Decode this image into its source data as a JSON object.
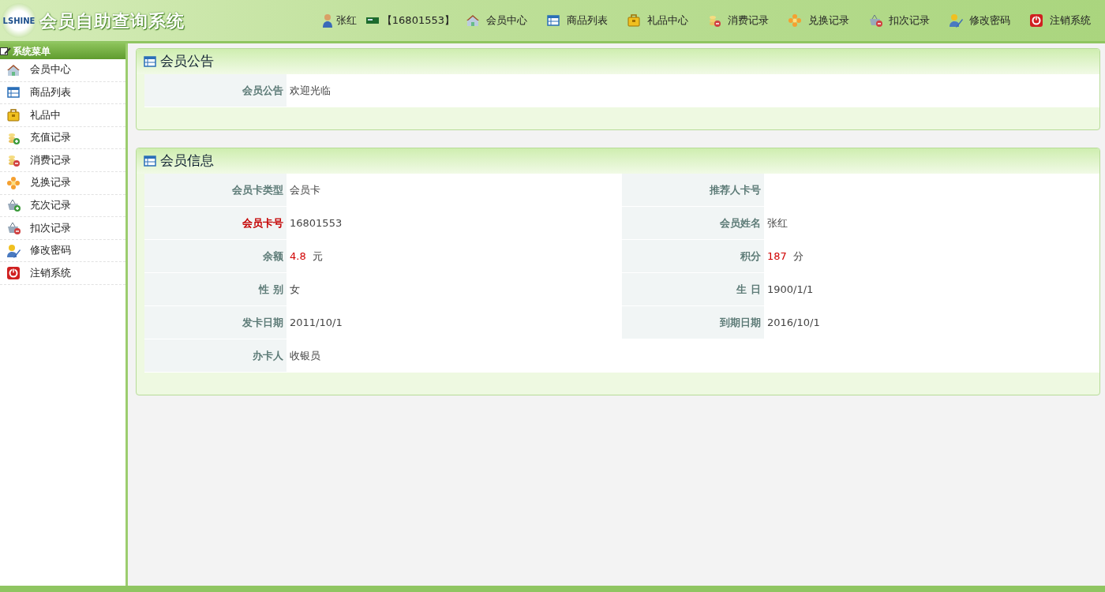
{
  "header": {
    "logo_text": "LSHINE",
    "title": "会员自助查询系统",
    "user_name": "张红",
    "card_number": "【16801553】",
    "nav": [
      {
        "label": "会员中心",
        "kind": "house"
      },
      {
        "label": "商品列表",
        "kind": "table"
      },
      {
        "label": "礼品中心",
        "kind": "bag"
      },
      {
        "label": "消费记录",
        "kind": "coins-minus"
      },
      {
        "label": "兑换记录",
        "kind": "flower"
      },
      {
        "label": "扣次记录",
        "kind": "basket-minus"
      },
      {
        "label": "修改密码",
        "kind": "pencil"
      },
      {
        "label": "注销系统",
        "kind": "power"
      }
    ]
  },
  "sidebar": {
    "title": "系统菜单",
    "items": [
      {
        "label": "会员中心",
        "kind": "house"
      },
      {
        "label": "商品列表",
        "kind": "table"
      },
      {
        "label": "礼品中",
        "kind": "bag"
      },
      {
        "label": "充值记录",
        "kind": "coins-plus"
      },
      {
        "label": "消费记录",
        "kind": "coins-minus"
      },
      {
        "label": "兑换记录",
        "kind": "flower"
      },
      {
        "label": "充次记录",
        "kind": "basket-plus"
      },
      {
        "label": "扣次记录",
        "kind": "basket-minus"
      },
      {
        "label": "修改密码",
        "kind": "pencil"
      },
      {
        "label": "注销系统",
        "kind": "power"
      }
    ]
  },
  "notice_panel": {
    "title": "会员公告",
    "label": "会员公告",
    "text": "欢迎光临"
  },
  "info_panel": {
    "title": "会员信息",
    "fields": [
      {
        "label": "会员卡类型",
        "value": "会员卡",
        "label_alert": false,
        "value_alert": false
      },
      {
        "label": "推荐人卡号",
        "label_alert": false
      },
      {
        "label": "会员卡号",
        "value": "16801553",
        "label_alert": true,
        "value_alert": false
      },
      {
        "label": "会员姓名",
        "value": "张红",
        "label_alert": false,
        "value_alert": false
      },
      {
        "label": "余额",
        "value": "4.8",
        "unit": "元",
        "label_alert": false,
        "value_alert": true
      },
      {
        "label": "积分",
        "value": "187",
        "unit": "分",
        "label_alert": false,
        "value_alert": true
      },
      {
        "label": "性 别",
        "value": "女",
        "label_alert": false,
        "value_alert": false
      },
      {
        "label": "生 日",
        "value": "1900/1/1",
        "label_alert": false,
        "value_alert": false
      },
      {
        "label": "发卡日期",
        "value": "2011/10/1",
        "label_alert": false,
        "value_alert": false
      },
      {
        "label": "到期日期",
        "value": "2016/10/1",
        "label_alert": false,
        "value_alert": false
      },
      {
        "label": "办卡人",
        "value": "收银员",
        "label_alert": false,
        "value_alert": false
      }
    ]
  }
}
